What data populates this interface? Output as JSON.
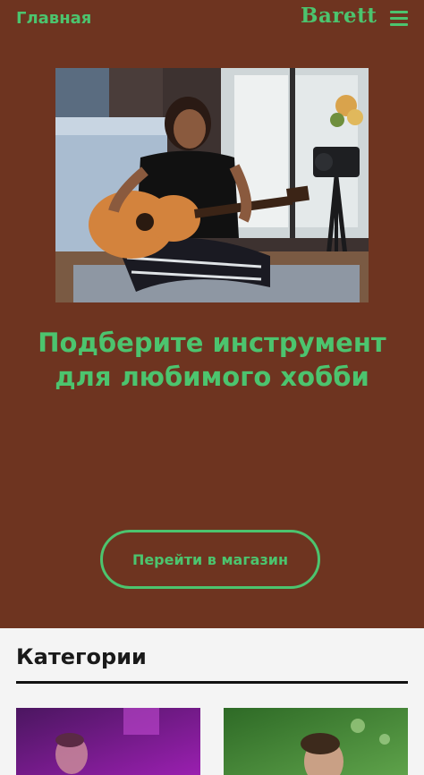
{
  "header": {
    "nav_home": "Главная",
    "brand": "Barett",
    "menu_icon": "hamburger-menu-icon"
  },
  "hero": {
    "image_icon": "guitar-player-photo",
    "headline_line1": "Подберите инструмент",
    "headline_line2": "для любимого хобби",
    "cta_label": "Перейти в магазин"
  },
  "categories": {
    "title": "Категории",
    "cards": [
      {
        "image": "concert-performer-photo"
      },
      {
        "image": "outdoor-portrait-photo"
      }
    ]
  },
  "colors": {
    "accent": "#4cc46e",
    "hero_bg": "#6e3420",
    "page_bg": "#f4f4f4"
  }
}
